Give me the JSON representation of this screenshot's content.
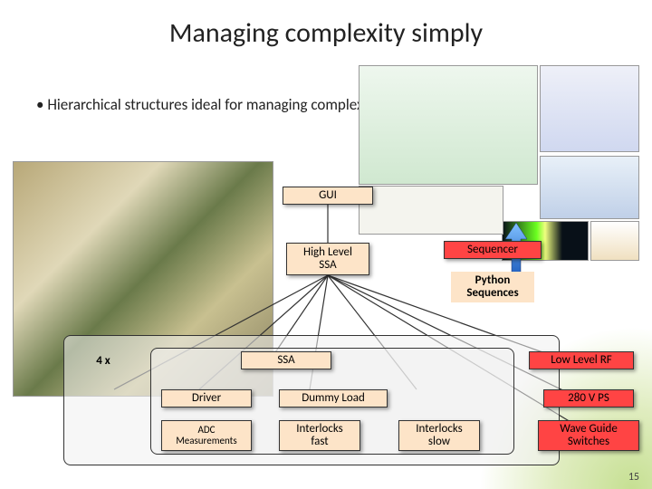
{
  "title": "Managing complexity simply",
  "bullet": "Hierarchical structures ideal for managing complex systems",
  "boxes": {
    "gui": "GUI",
    "hlssa": "High Level\nSSA",
    "sequencer": "Sequencer",
    "python": "Python\nSequences",
    "fourx": "4 x",
    "ssa": "SSA",
    "llrf": "Low Level RF",
    "driver": "Driver",
    "dummy": "Dummy Load",
    "ps": "280 V PS",
    "adc": "ADC\nMeasurements",
    "ilfast": "Interlocks\nfast",
    "ilslow": "Interlocks\nslow",
    "wgs": "Wave Guide\nSwitches"
  },
  "pagenum": "15"
}
